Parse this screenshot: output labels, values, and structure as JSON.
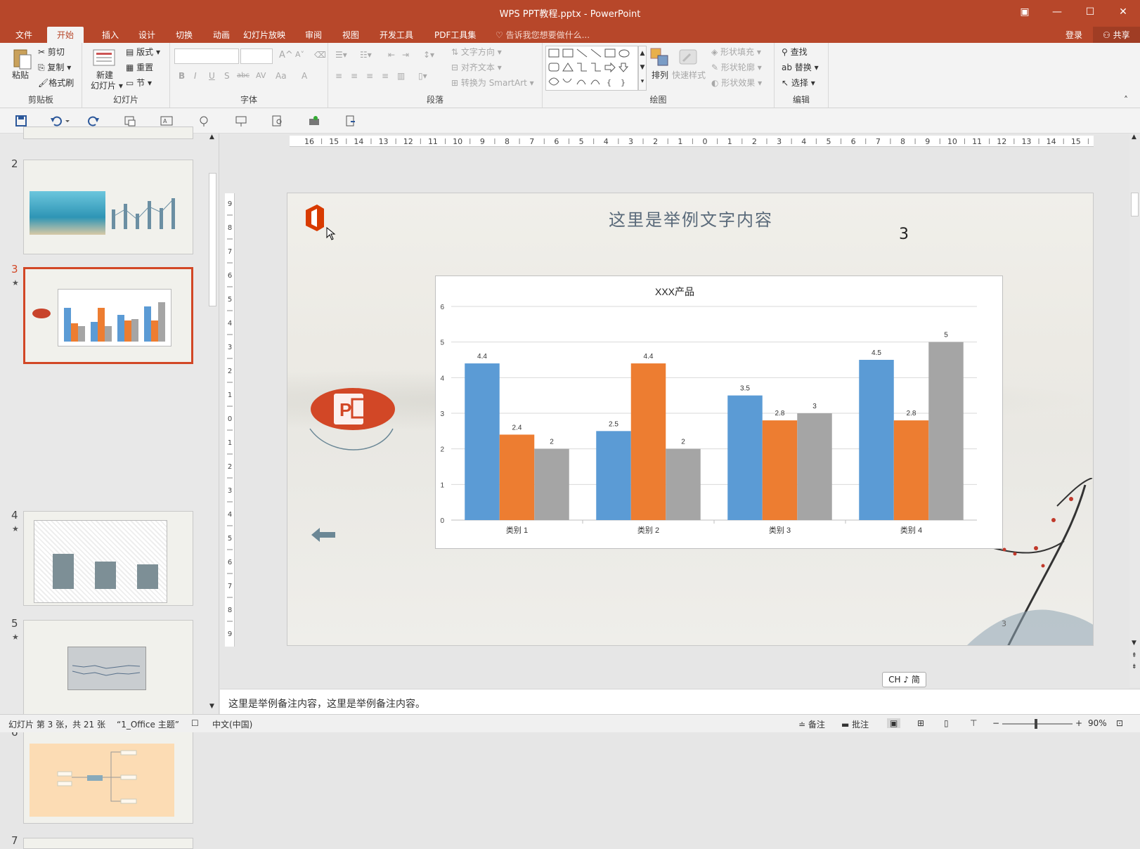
{
  "window": {
    "title": "WPS PPT教程.pptx - PowerPoint",
    "login": "登录",
    "share": "共享"
  },
  "tabs": [
    "文件",
    "开始",
    "插入",
    "设计",
    "切换",
    "动画",
    "幻灯片放映",
    "审阅",
    "视图",
    "开发工具",
    "PDF工具集"
  ],
  "tellme": "告诉我您想要做什么...",
  "ribbon": {
    "clipboard": {
      "label": "剪贴板",
      "paste": "粘贴",
      "cut": "剪切",
      "copy": "复制",
      "format_painter": "格式刷"
    },
    "slides": {
      "label": "幻灯片",
      "new_slide_1": "新建",
      "new_slide_2": "幻灯片",
      "layout": "版式",
      "reset": "重置",
      "section": "节"
    },
    "font": {
      "label": "字体",
      "bold": "B",
      "italic": "I",
      "underline": "U",
      "shadow": "S",
      "strike": "abc",
      "spacing": "AV",
      "case": "Aa",
      "color": "A"
    },
    "paragraph": {
      "label": "段落",
      "text_direction": "文字方向",
      "align_text": "对齐文本",
      "smartart": "转换为 SmartArt"
    },
    "drawing": {
      "label": "绘图",
      "arrange": "排列",
      "quick_styles": "快速样式",
      "shape_fill": "形状填充",
      "shape_outline": "形状轮廓",
      "shape_effects": "形状效果"
    },
    "editing": {
      "label": "编辑",
      "find": "查找",
      "replace": "替换",
      "select": "选择"
    }
  },
  "thumbnails": [
    {
      "num": "2",
      "star": ""
    },
    {
      "num": "3",
      "star": "★"
    },
    {
      "num": "4",
      "star": "★"
    },
    {
      "num": "5",
      "star": "★"
    },
    {
      "num": "6",
      "star": ""
    },
    {
      "num": "7",
      "star": ""
    }
  ],
  "ruler": {
    "h_ticks": [
      "16",
      "15",
      "14",
      "13",
      "12",
      "11",
      "10",
      "9",
      "8",
      "7",
      "6",
      "5",
      "4",
      "3",
      "2",
      "1",
      "0",
      "1",
      "2",
      "3",
      "4",
      "5",
      "6",
      "7",
      "8",
      "9",
      "10",
      "11",
      "12",
      "13",
      "14",
      "15",
      "16"
    ],
    "v_ticks": [
      "9",
      "8",
      "7",
      "6",
      "5",
      "4",
      "3",
      "2",
      "1",
      "0",
      "1",
      "2",
      "3",
      "4",
      "5",
      "6",
      "7",
      "8",
      "9"
    ]
  },
  "slide": {
    "title": "这里是举例文字内容",
    "number": "3",
    "footer_number": "3"
  },
  "chart_data": {
    "type": "bar",
    "title": "XXX产品",
    "categories": [
      "类别 1",
      "类别 2",
      "类别 3",
      "类别 4"
    ],
    "series": [
      {
        "values": [
          4.4,
          2.5,
          3.5,
          4.5
        ],
        "color": "#5b9bd5"
      },
      {
        "values": [
          2.4,
          4.4,
          2.8,
          2.8
        ],
        "color": "#ed7d31"
      },
      {
        "values": [
          2,
          2,
          3,
          5
        ],
        "color": "#a5a5a5"
      }
    ],
    "ylim": [
      0,
      6
    ],
    "yticks": [
      "0",
      "1",
      "2",
      "3",
      "4",
      "5",
      "6"
    ],
    "grid": true,
    "data_labels": true
  },
  "notes": "这里是举例备注内容，这里是举例备注内容。",
  "ime": "CH ♪ 简",
  "status": {
    "slide_info": "幻灯片 第 3 张，共 21 张",
    "theme": "“1_Office 主题”",
    "language": "中文(中国)",
    "notes_btn": "备注",
    "comments_btn": "批注",
    "zoom": "90%"
  },
  "colors": {
    "accent": "#b7472a",
    "selected_border": "#d24726"
  }
}
